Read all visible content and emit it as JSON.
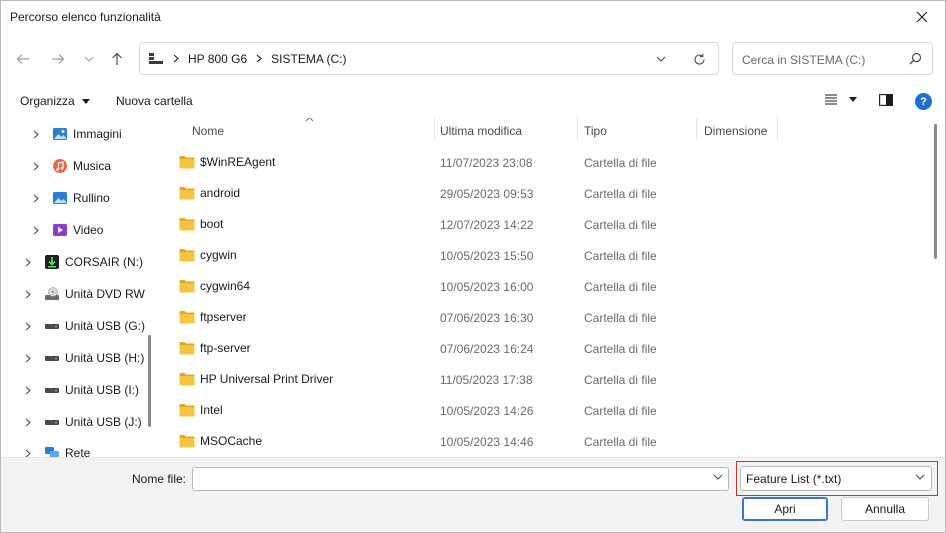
{
  "window": {
    "title": "Percorso elenco funzionalità"
  },
  "address": {
    "segments": [
      "HP 800 G6",
      "SISTEMA (C:)"
    ]
  },
  "search": {
    "placeholder": "Cerca in SISTEMA (C:)"
  },
  "toolbar": {
    "organize_label": "Organizza",
    "new_folder_label": "Nuova cartella",
    "help_label": "?"
  },
  "nav": {
    "items": [
      {
        "label": "Immagini",
        "icon": "pictures-icon"
      },
      {
        "label": "Musica",
        "icon": "music-icon"
      },
      {
        "label": "Rullino",
        "icon": "camera-roll-icon"
      },
      {
        "label": "Video",
        "icon": "video-icon"
      },
      {
        "label": "CORSAIR (N:)",
        "icon": "usb-drive-icon"
      },
      {
        "label": "Unità DVD RW",
        "icon": "dvd-drive-icon"
      },
      {
        "label": "Unità USB (G:)",
        "icon": "drive-icon"
      },
      {
        "label": "Unità USB (H:)",
        "icon": "drive-icon"
      },
      {
        "label": "Unità USB (I:)",
        "icon": "drive-icon"
      },
      {
        "label": "Unità USB (J:)",
        "icon": "drive-icon"
      },
      {
        "label": "Rete",
        "icon": "network-icon"
      }
    ]
  },
  "columns": {
    "name": "Nome",
    "modified": "Ultima modifica",
    "type": "Tipo",
    "size": "Dimensione"
  },
  "files": [
    {
      "name": "$WinREAgent",
      "modified": "11/07/2023 23:08",
      "type": "Cartella di file"
    },
    {
      "name": "android",
      "modified": "29/05/2023 09:53",
      "type": "Cartella di file"
    },
    {
      "name": "boot",
      "modified": "12/07/2023 14:22",
      "type": "Cartella di file"
    },
    {
      "name": "cygwin",
      "modified": "10/05/2023 15:50",
      "type": "Cartella di file"
    },
    {
      "name": "cygwin64",
      "modified": "10/05/2023 16:00",
      "type": "Cartella di file"
    },
    {
      "name": "ftpserver",
      "modified": "07/06/2023 16:30",
      "type": "Cartella di file"
    },
    {
      "name": "ftp-server",
      "modified": "07/06/2023 16:24",
      "type": "Cartella di file"
    },
    {
      "name": "HP Universal Print Driver",
      "modified": "11/05/2023 17:38",
      "type": "Cartella di file"
    },
    {
      "name": "Intel",
      "modified": "10/05/2023 14:26",
      "type": "Cartella di file"
    },
    {
      "name": "MSOCache",
      "modified": "10/05/2023 14:46",
      "type": "Cartella di file"
    }
  ],
  "bottom": {
    "filename_label": "Nome file:",
    "filename_value": "",
    "filter_value": "Feature List (*.txt)",
    "open_label": "Apri",
    "cancel_label": "Annulla"
  },
  "colors": {
    "folder": "#f5c542",
    "folder_dark": "#e0a81e",
    "accent": "#3b73c8",
    "highlight": "#d32f2f"
  }
}
